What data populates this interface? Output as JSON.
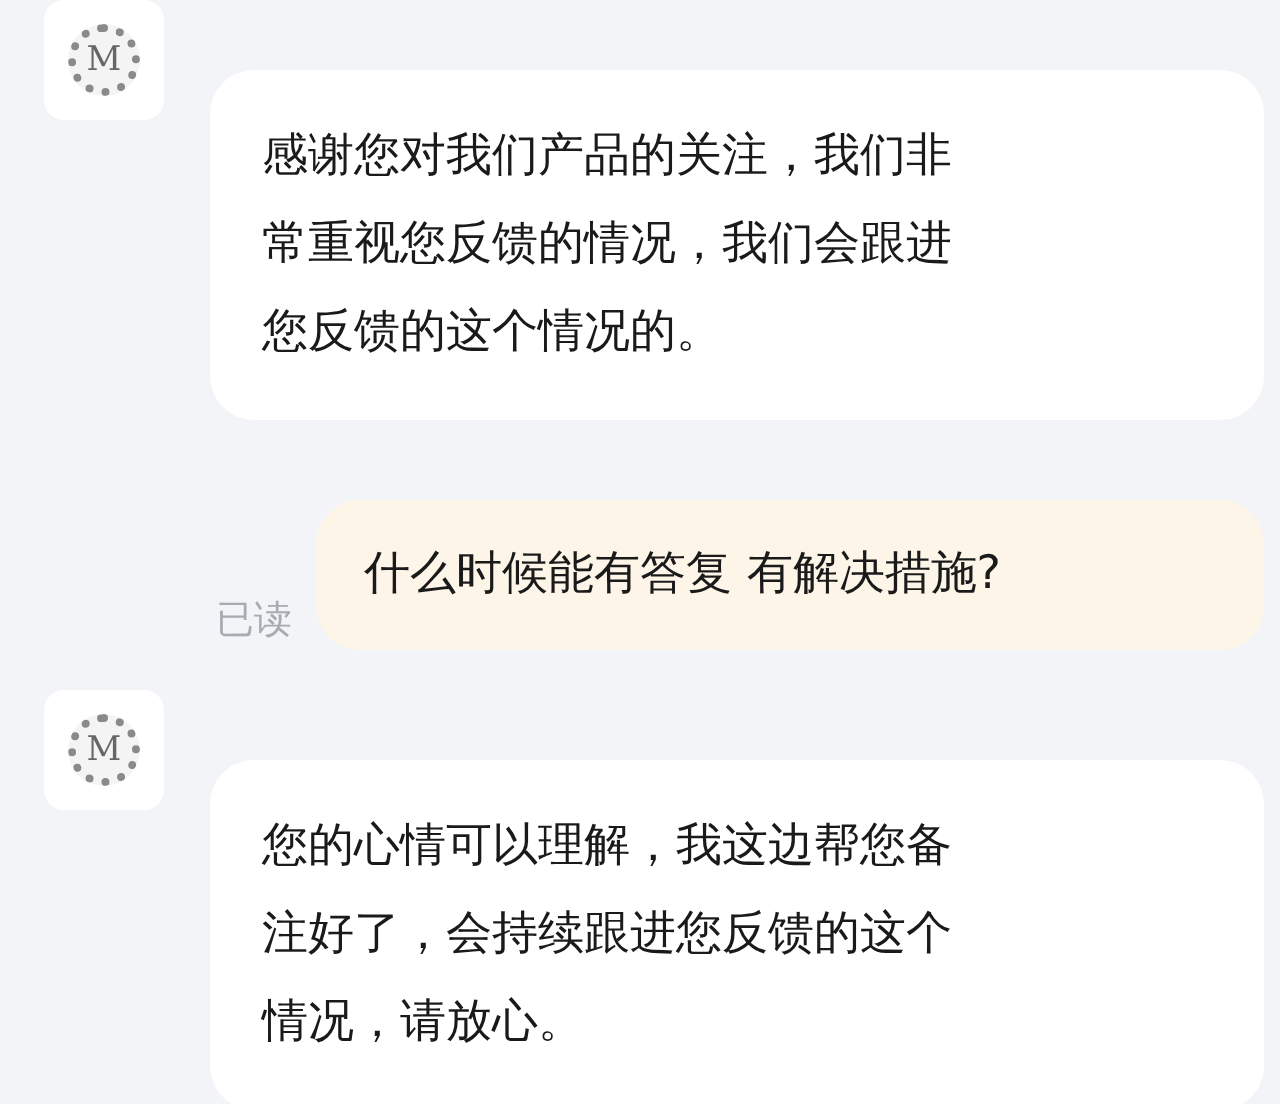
{
  "messages": [
    {
      "kind": "received",
      "avatar_letter": "M",
      "text": "感谢您对我们产品的关注，我们非常重视您反馈的情况，我们会跟进您反馈的这个情况的。"
    },
    {
      "kind": "sent",
      "status": "已读",
      "text": "什么时候能有答复 有解决措施?"
    },
    {
      "kind": "received",
      "avatar_letter": "M",
      "text": "您的心情可以理解，我这边帮您备注好了，会持续跟进您反馈的这个情况，请放心。"
    }
  ]
}
